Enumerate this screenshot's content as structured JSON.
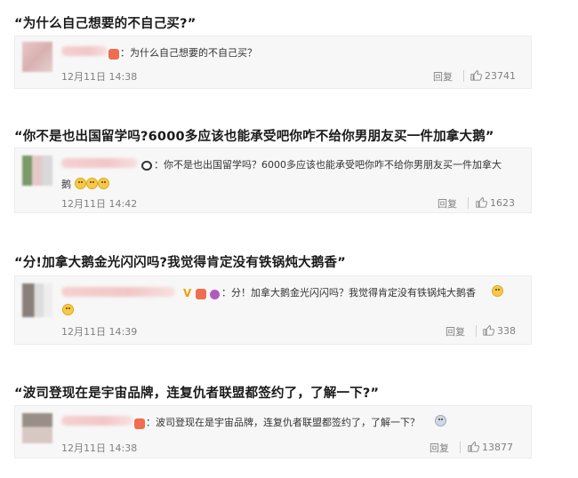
{
  "posts": [
    {
      "quote": "“为什么自己想要的不自己买?”",
      "comment": "：为什么自己想要的不自己买？",
      "date": "12月11日 14:38",
      "reply_label": "回复",
      "likes": "23741"
    },
    {
      "quote": "“你不是也出国留学吗?6000多应该也能承受吧你咋不给你男朋友买一件加拿大鹅”",
      "comment_line1": "：你不是也出国留学吗？6000多应该也能承受吧你咋不给你男朋友买一件加拿大",
      "comment_line2": "鹅",
      "date": "12月11日 14:42",
      "reply_label": "回复",
      "likes": "1623"
    },
    {
      "quote": "“分!加拿大鹅金光闪闪吗?我觉得肯定没有铁锅炖大鹅香”",
      "badge_v": "V",
      "comment": "：分！加拿大鹅金光闪闪吗？我觉得肯定没有铁锅炖大鹅香",
      "date": "12月11日 14:39",
      "reply_label": "回复",
      "likes": "338"
    },
    {
      "quote": "“波司登现在是宇宙品牌，连复仇者联盟都签约了，了解一下?”",
      "comment": "：波司登现在是宇宙品牌，连复仇者联盟都签约了，了解一下？",
      "date": "12月11日 14:38",
      "reply_label": "回复",
      "likes": "13877"
    }
  ],
  "colors": {
    "card_bg": "#f7f7f8",
    "card_border": "#ececee",
    "meta_text": "#808080",
    "quote_text": "#1a1a1a"
  },
  "icons": [
    "thumbs-up-icon",
    "emoji-icon",
    "badge-icon",
    "panda-icon",
    "flower-icon",
    "verified-v-icon"
  ]
}
